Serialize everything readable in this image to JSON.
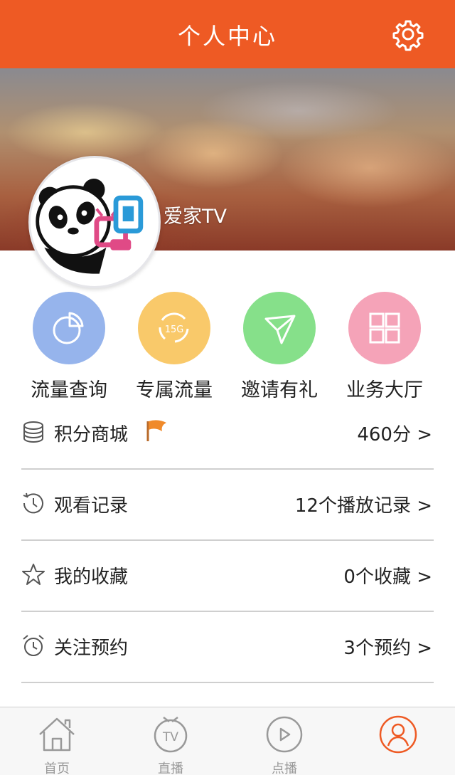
{
  "header": {
    "title": "个人中心",
    "settings_icon": "gear-icon"
  },
  "profile": {
    "nickname": "爱家TV",
    "avatar_icon": "panda-tv-logo"
  },
  "quick_actions": [
    {
      "label": "流量查询",
      "icon": "pie-chart-icon",
      "color": "#96b4ec"
    },
    {
      "label": "专属流量",
      "icon": "15g-recycle-icon",
      "color": "#f9c96a"
    },
    {
      "label": "邀请有礼",
      "icon": "paper-plane-icon",
      "color": "#86e08a"
    },
    {
      "label": "业务大厅",
      "icon": "grid-icon",
      "color": "#f5a3b8"
    }
  ],
  "menu": [
    {
      "label": "积分商城",
      "value": "460分 >",
      "icon": "coins-icon",
      "badge_icon": "flag-icon"
    },
    {
      "label": "观看记录",
      "value": "12个播放记录 >",
      "icon": "history-icon"
    },
    {
      "label": "我的收藏",
      "value": "0个收藏 >",
      "icon": "star-icon"
    },
    {
      "label": "关注预约",
      "value": "3个预约 >",
      "icon": "alarm-clock-icon"
    }
  ],
  "tabs": [
    {
      "label": "首页",
      "icon": "home-icon",
      "active": false
    },
    {
      "label": "直播",
      "icon": "tv-icon",
      "active": false
    },
    {
      "label": "点播",
      "icon": "play-icon",
      "active": false
    },
    {
      "label": "",
      "icon": "user-icon",
      "active": true
    }
  ],
  "colors": {
    "accent": "#ee5a24",
    "divider": "#cfcfcf",
    "tab_inactive": "#999999"
  }
}
